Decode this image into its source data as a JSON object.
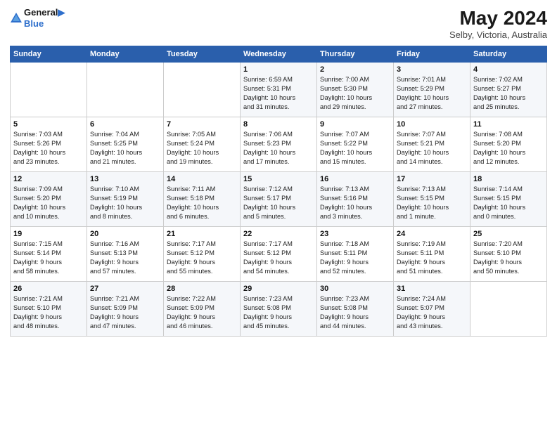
{
  "header": {
    "logo_line1": "General",
    "logo_line2": "Blue",
    "main_title": "May 2024",
    "subtitle": "Selby, Victoria, Australia"
  },
  "weekdays": [
    "Sunday",
    "Monday",
    "Tuesday",
    "Wednesday",
    "Thursday",
    "Friday",
    "Saturday"
  ],
  "weeks": [
    [
      {
        "day": "",
        "info": ""
      },
      {
        "day": "",
        "info": ""
      },
      {
        "day": "",
        "info": ""
      },
      {
        "day": "1",
        "info": "Sunrise: 6:59 AM\nSunset: 5:31 PM\nDaylight: 10 hours\nand 31 minutes."
      },
      {
        "day": "2",
        "info": "Sunrise: 7:00 AM\nSunset: 5:30 PM\nDaylight: 10 hours\nand 29 minutes."
      },
      {
        "day": "3",
        "info": "Sunrise: 7:01 AM\nSunset: 5:29 PM\nDaylight: 10 hours\nand 27 minutes."
      },
      {
        "day": "4",
        "info": "Sunrise: 7:02 AM\nSunset: 5:27 PM\nDaylight: 10 hours\nand 25 minutes."
      }
    ],
    [
      {
        "day": "5",
        "info": "Sunrise: 7:03 AM\nSunset: 5:26 PM\nDaylight: 10 hours\nand 23 minutes."
      },
      {
        "day": "6",
        "info": "Sunrise: 7:04 AM\nSunset: 5:25 PM\nDaylight: 10 hours\nand 21 minutes."
      },
      {
        "day": "7",
        "info": "Sunrise: 7:05 AM\nSunset: 5:24 PM\nDaylight: 10 hours\nand 19 minutes."
      },
      {
        "day": "8",
        "info": "Sunrise: 7:06 AM\nSunset: 5:23 PM\nDaylight: 10 hours\nand 17 minutes."
      },
      {
        "day": "9",
        "info": "Sunrise: 7:07 AM\nSunset: 5:22 PM\nDaylight: 10 hours\nand 15 minutes."
      },
      {
        "day": "10",
        "info": "Sunrise: 7:07 AM\nSunset: 5:21 PM\nDaylight: 10 hours\nand 14 minutes."
      },
      {
        "day": "11",
        "info": "Sunrise: 7:08 AM\nSunset: 5:20 PM\nDaylight: 10 hours\nand 12 minutes."
      }
    ],
    [
      {
        "day": "12",
        "info": "Sunrise: 7:09 AM\nSunset: 5:20 PM\nDaylight: 10 hours\nand 10 minutes."
      },
      {
        "day": "13",
        "info": "Sunrise: 7:10 AM\nSunset: 5:19 PM\nDaylight: 10 hours\nand 8 minutes."
      },
      {
        "day": "14",
        "info": "Sunrise: 7:11 AM\nSunset: 5:18 PM\nDaylight: 10 hours\nand 6 minutes."
      },
      {
        "day": "15",
        "info": "Sunrise: 7:12 AM\nSunset: 5:17 PM\nDaylight: 10 hours\nand 5 minutes."
      },
      {
        "day": "16",
        "info": "Sunrise: 7:13 AM\nSunset: 5:16 PM\nDaylight: 10 hours\nand 3 minutes."
      },
      {
        "day": "17",
        "info": "Sunrise: 7:13 AM\nSunset: 5:15 PM\nDaylight: 10 hours\nand 1 minute."
      },
      {
        "day": "18",
        "info": "Sunrise: 7:14 AM\nSunset: 5:15 PM\nDaylight: 10 hours\nand 0 minutes."
      }
    ],
    [
      {
        "day": "19",
        "info": "Sunrise: 7:15 AM\nSunset: 5:14 PM\nDaylight: 9 hours\nand 58 minutes."
      },
      {
        "day": "20",
        "info": "Sunrise: 7:16 AM\nSunset: 5:13 PM\nDaylight: 9 hours\nand 57 minutes."
      },
      {
        "day": "21",
        "info": "Sunrise: 7:17 AM\nSunset: 5:12 PM\nDaylight: 9 hours\nand 55 minutes."
      },
      {
        "day": "22",
        "info": "Sunrise: 7:17 AM\nSunset: 5:12 PM\nDaylight: 9 hours\nand 54 minutes."
      },
      {
        "day": "23",
        "info": "Sunrise: 7:18 AM\nSunset: 5:11 PM\nDaylight: 9 hours\nand 52 minutes."
      },
      {
        "day": "24",
        "info": "Sunrise: 7:19 AM\nSunset: 5:11 PM\nDaylight: 9 hours\nand 51 minutes."
      },
      {
        "day": "25",
        "info": "Sunrise: 7:20 AM\nSunset: 5:10 PM\nDaylight: 9 hours\nand 50 minutes."
      }
    ],
    [
      {
        "day": "26",
        "info": "Sunrise: 7:21 AM\nSunset: 5:10 PM\nDaylight: 9 hours\nand 48 minutes."
      },
      {
        "day": "27",
        "info": "Sunrise: 7:21 AM\nSunset: 5:09 PM\nDaylight: 9 hours\nand 47 minutes."
      },
      {
        "day": "28",
        "info": "Sunrise: 7:22 AM\nSunset: 5:09 PM\nDaylight: 9 hours\nand 46 minutes."
      },
      {
        "day": "29",
        "info": "Sunrise: 7:23 AM\nSunset: 5:08 PM\nDaylight: 9 hours\nand 45 minutes."
      },
      {
        "day": "30",
        "info": "Sunrise: 7:23 AM\nSunset: 5:08 PM\nDaylight: 9 hours\nand 44 minutes."
      },
      {
        "day": "31",
        "info": "Sunrise: 7:24 AM\nSunset: 5:07 PM\nDaylight: 9 hours\nand 43 minutes."
      },
      {
        "day": "",
        "info": ""
      }
    ]
  ]
}
